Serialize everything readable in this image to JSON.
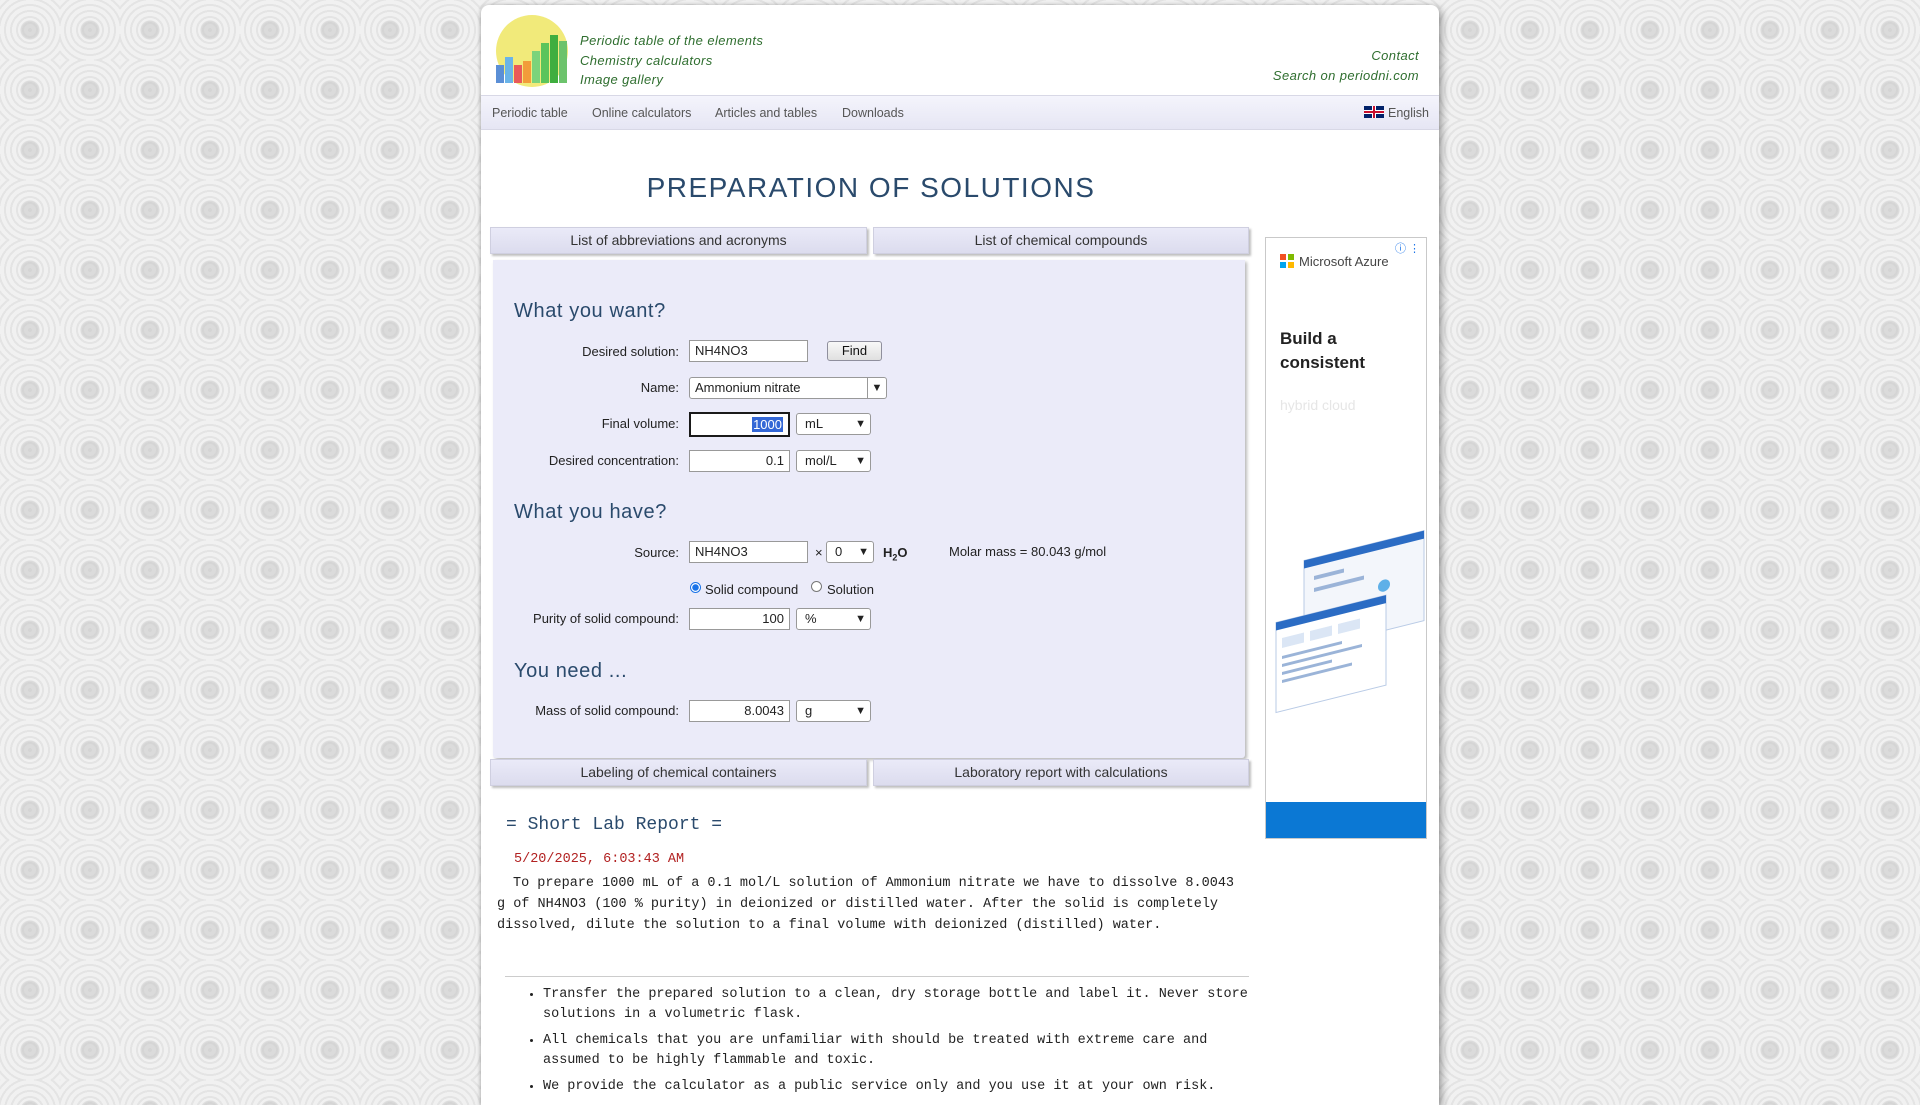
{
  "header": {
    "links": [
      "Periodic table of the elements",
      "Chemistry calculators",
      "Image gallery"
    ],
    "contact": "Contact",
    "search": "Search on periodni.com"
  },
  "nav": {
    "items": [
      "Periodic table",
      "Online calculators",
      "Articles and tables",
      "Downloads"
    ],
    "language": "English"
  },
  "title": "PREPARATION OF SOLUTIONS",
  "tabs": {
    "abbreviations": "List of abbreviations and acronyms",
    "compounds": "List of chemical compounds",
    "labeling": "Labeling of chemical containers",
    "lab_report": "Laboratory report with calculations"
  },
  "form": {
    "want_heading": "What you want?",
    "desired_solution_label": "Desired solution:",
    "desired_solution_value": "NH4NO3",
    "find_button": "Find",
    "name_label": "Name:",
    "name_value": "Ammonium nitrate",
    "final_volume_label": "Final volume:",
    "final_volume_value": "1000",
    "final_volume_unit": "mL",
    "concentration_label": "Desired concentration:",
    "concentration_value": "0.1",
    "concentration_unit": "mol/L",
    "have_heading": "What you have?",
    "source_label": "Source:",
    "source_value": "NH4NO3",
    "times": "×",
    "hydrate_value": "0",
    "water_h": "H",
    "water_sub": "2",
    "water_o": "O",
    "molar_mass": "Molar mass = 80.043 g/mol",
    "solid_label": "Solid compound",
    "solution_label": "Solution",
    "source_type": "Solid compound",
    "purity_label": "Purity of solid compound:",
    "purity_value": "100",
    "purity_unit": "%",
    "need_heading": "You need ...",
    "mass_label": "Mass of solid compound:",
    "mass_value": "8.0043",
    "mass_unit": "g"
  },
  "report": {
    "title": "= Short Lab Report =",
    "date": "5/20/2025, 6:03:43 AM",
    "paragraph": "To prepare 1000 mL of a 0.1 mol/L solution of Ammonium nitrate we have to dissolve 8.0043 g of NH4NO3 (100 % purity) in deionized or distilled water. After the solid is completely dissolved, dilute the solution to a final volume with deionized (distilled) water.",
    "bullets": [
      "Transfer the prepared solution to a clean, dry storage bottle and label it. Never store solutions in a volumetric flask.",
      "All chemicals that you are unfamiliar with should be treated with extreme care and assumed to be highly flammable and toxic.",
      "We provide the calculator as a public service only and you use it at your own risk."
    ]
  },
  "ad": {
    "brand": "Microsoft Azure",
    "headline": "Build a consistent",
    "faded": "hybrid cloud"
  },
  "colors": {
    "title": "#2a4a6c",
    "links": "#2f6e2f",
    "panel": "#ebebf9",
    "date": "#b22222",
    "ad_cta": "#0b78d4"
  }
}
